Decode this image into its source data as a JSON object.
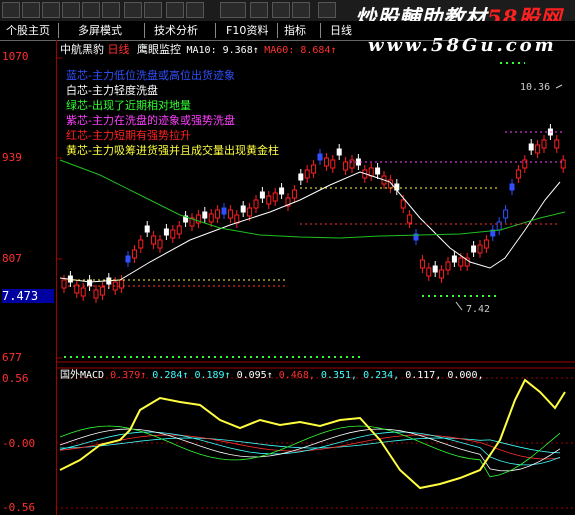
{
  "watermark": {
    "part1": "炒股輔助教材",
    "part2": "58股网",
    "domain": "www.58Gu.com"
  },
  "menu": [
    {
      "label": "个股主页"
    },
    {
      "label": "多屏模式"
    },
    {
      "label": "技术分析"
    },
    {
      "label": "F10资料"
    },
    {
      "label": "指标"
    },
    {
      "label": "日线"
    }
  ],
  "stock": {
    "name": "中航黑豹",
    "period": "日线",
    "indicator": "鹰眼监控",
    "ma10": "MA10: 9.368↑",
    "ma60": "MA60: 8.684↑"
  },
  "price_axis": {
    "labels": [
      "1070",
      "939",
      "807",
      "677"
    ],
    "current": "7.473"
  },
  "legend": [
    {
      "text": "蓝芯-主力低位洗盘或高位出货迹象",
      "color": "#3050ff"
    },
    {
      "text": "白芯-主力轻度洗盘",
      "color": "#ffffff"
    },
    {
      "text": "绿芯-出现了近期相对地量",
      "color": "#30ff30"
    },
    {
      "text": "紫芯-主力在洗盘的迹象或强势洗盘",
      "color": "#ff40ff"
    },
    {
      "text": "红芯-主力短期有强势拉升",
      "color": "#ff2020"
    },
    {
      "text": "黄芯-主力吸筹进货强并且成交量出现黄金柱",
      "color": "#ffff40"
    }
  ],
  "annotations": {
    "high": "10.36",
    "low": "7.42"
  },
  "macd": {
    "title": "国外MACD",
    "values": [
      {
        "text": "0.379↑",
        "color": "#ff3030"
      },
      {
        "text": "0.284↑",
        "color": "#40ffff"
      },
      {
        "text": "0.189↑",
        "color": "#40ffff"
      },
      {
        "text": "0.095↑",
        "color": "#ffffff"
      },
      {
        "text": "0.468,",
        "color": "#ff3030"
      },
      {
        "text": "0.351,",
        "color": "#40ffff"
      },
      {
        "text": "0.234,",
        "color": "#40ffff"
      },
      {
        "text": "0.117,",
        "color": "#ffffff"
      },
      {
        "text": "0.000,",
        "color": "#ffffff"
      }
    ],
    "axis": [
      "0.56",
      "-0.00",
      "-0.56"
    ]
  },
  "colors": {
    "up": "#ff2020",
    "down": "#3050ff",
    "axis": "#a00000",
    "ma_white": "#ffffff",
    "ma_green": "#20c020"
  }
}
